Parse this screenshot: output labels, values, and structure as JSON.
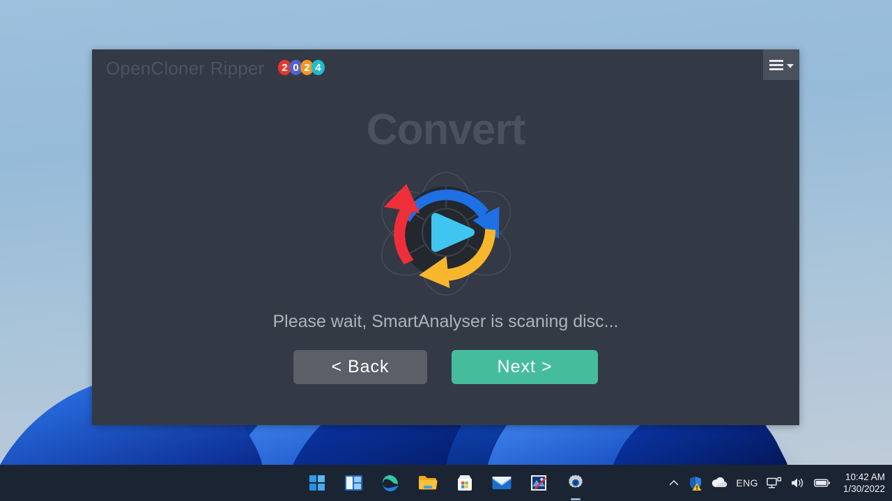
{
  "window": {
    "app_title": "OpenCloner Ripper",
    "year_badge": {
      "digits": [
        {
          "char": "2",
          "color": "#e8362a"
        },
        {
          "char": "0",
          "color": "#4f62cf"
        },
        {
          "char": "2",
          "color": "#f0981e"
        },
        {
          "char": "4",
          "color": "#1fbcd0"
        }
      ]
    },
    "menu_button_label": "Menu"
  },
  "page": {
    "title": "Convert",
    "status_text": "Please wait, SmartAnalyser is scaning disc...",
    "logo_alt": "convert-arrows-logo"
  },
  "buttons": {
    "back_label": "<  Back",
    "next_label": "Next  >"
  },
  "taskbar": {
    "icons": [
      {
        "name": "start-icon",
        "label": "Start"
      },
      {
        "name": "widgets-icon",
        "label": "Widgets"
      },
      {
        "name": "edge-icon",
        "label": "Microsoft Edge"
      },
      {
        "name": "file-explorer-icon",
        "label": "File Explorer"
      },
      {
        "name": "microsoft-store-icon",
        "label": "Microsoft Store"
      },
      {
        "name": "mail-icon",
        "label": "Mail"
      },
      {
        "name": "photos-icon",
        "label": "Photos"
      },
      {
        "name": "settings-icon",
        "label": "Settings",
        "active": true
      }
    ],
    "tray": {
      "chevron_label": "Show hidden icons",
      "defender_label": "Windows Security",
      "onedrive_label": "OneDrive",
      "language": "ENG",
      "network_label": "Network",
      "volume_label": "Volume",
      "battery_label": "Battery",
      "time": "10:42 AM",
      "date": "1/30/2022"
    }
  },
  "colors": {
    "window_bg": "#343a45",
    "accent_next": "#45bd9d",
    "back_btn": "#5a5f68",
    "title_text": "#4b525e",
    "status_text": "#aeb3bb",
    "taskbar_bg": "#1b2433",
    "desktop_blue": "#9cc0dd"
  }
}
